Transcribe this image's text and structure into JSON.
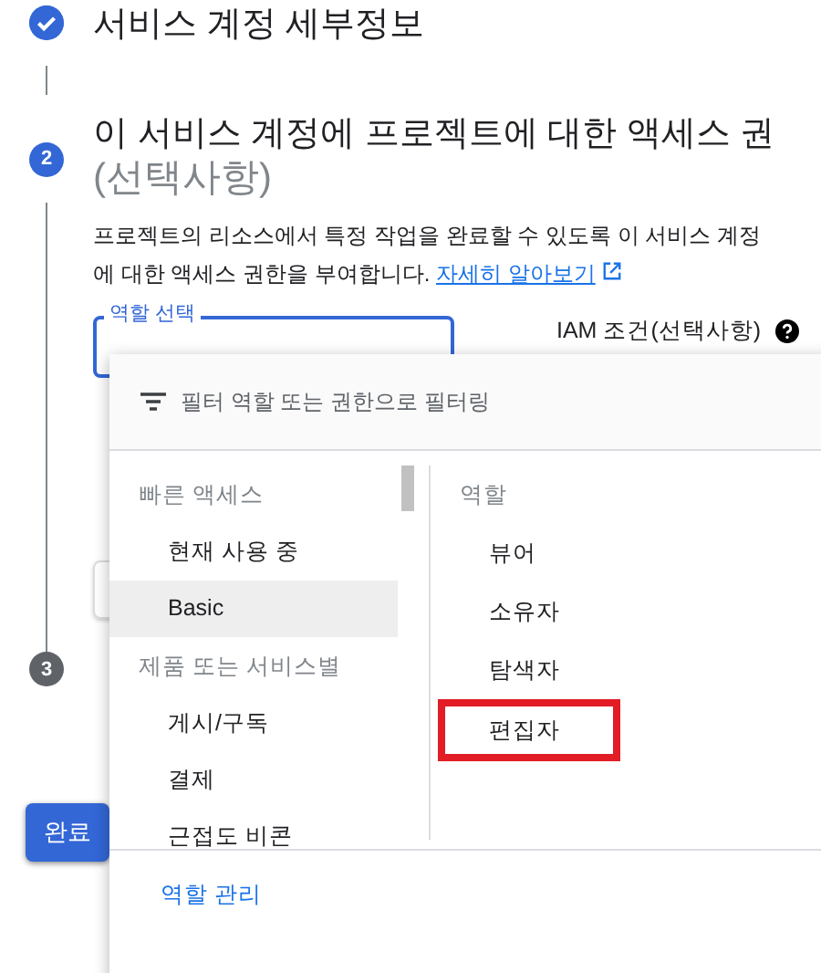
{
  "steps": [
    {
      "kind": "done",
      "title": "서비스 계정 세부정보"
    },
    {
      "kind": "active",
      "number": "2",
      "title": "이 서비스 계정에 프로젝트에 대한 액세스 권",
      "subtitle": "(선택사항)"
    },
    {
      "kind": "pending",
      "number": "3"
    }
  ],
  "description": {
    "text": "프로젝트의 리소스에서 특정 작업을 완료할 수 있도록 이 서비스 계정",
    "text_line2": "에 대한 액세스 권한을 부여합니다.",
    "link": "자세히 알아보기"
  },
  "role_field": {
    "label": "역할 선택"
  },
  "iam_condition": {
    "label": "IAM 조건(선택사항)"
  },
  "done_button": "완료",
  "menu": {
    "filter": {
      "placeholder": "필터 역할 또는 권한으로 필터링"
    },
    "left_list": [
      {
        "kind": "header",
        "label": "빠른 액세스"
      },
      {
        "kind": "item",
        "label": "현재 사용 중",
        "selected": false
      },
      {
        "kind": "item",
        "label": "Basic",
        "selected": true
      },
      {
        "kind": "header",
        "label": "제품 또는 서비스별"
      },
      {
        "kind": "item",
        "label": "게시/구독",
        "selected": false
      },
      {
        "kind": "item",
        "label": "결제",
        "selected": false
      },
      {
        "kind": "item",
        "label": "근접도 비콘",
        "selected": false
      }
    ],
    "right_header": "역할",
    "roles": [
      {
        "label": "뷰어",
        "highlighted": false
      },
      {
        "label": "소유자",
        "highlighted": false
      },
      {
        "label": "탐색자",
        "highlighted": false
      },
      {
        "label": "편집자",
        "highlighted": true
      }
    ],
    "manage_link": "역할 관리"
  }
}
